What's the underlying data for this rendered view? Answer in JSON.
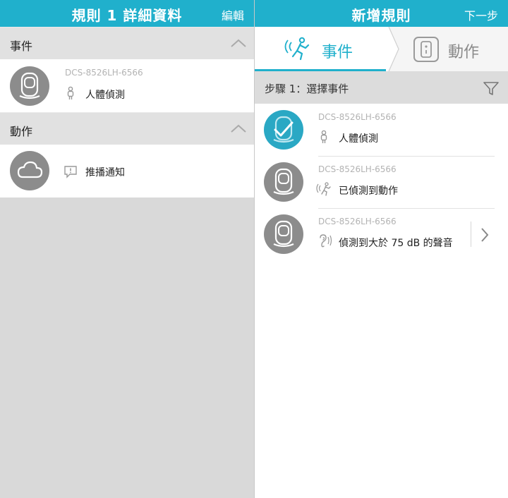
{
  "left": {
    "header": {
      "title": "規則 1 詳細資料",
      "action": "編輯"
    },
    "events_section": {
      "label": "事件"
    },
    "event_item": {
      "device": "DCS-8526LH-6566",
      "type": "人體偵測"
    },
    "actions_section": {
      "label": "動作"
    },
    "action_item": {
      "type": "推播通知"
    }
  },
  "right": {
    "header": {
      "title": "新增規則",
      "action": "下一步"
    },
    "tabs": [
      {
        "label": "事件",
        "active": true
      },
      {
        "label": "動作",
        "active": false
      }
    ],
    "step": {
      "label": "步驟 1：選擇事件"
    },
    "events": [
      {
        "device": "DCS-8526LH-6566",
        "type": "人體偵測",
        "selected": true
      },
      {
        "device": "DCS-8526LH-6566",
        "type": "已偵測到動作",
        "selected": false
      },
      {
        "device": "DCS-8526LH-6566",
        "type": "偵測到大於 75 dB 的聲音",
        "selected": false,
        "has_submenu": true
      }
    ]
  },
  "colors": {
    "accent": "#20b0cc",
    "icon_gray": "#8c8c8c",
    "selected": "#2aa8c4"
  }
}
